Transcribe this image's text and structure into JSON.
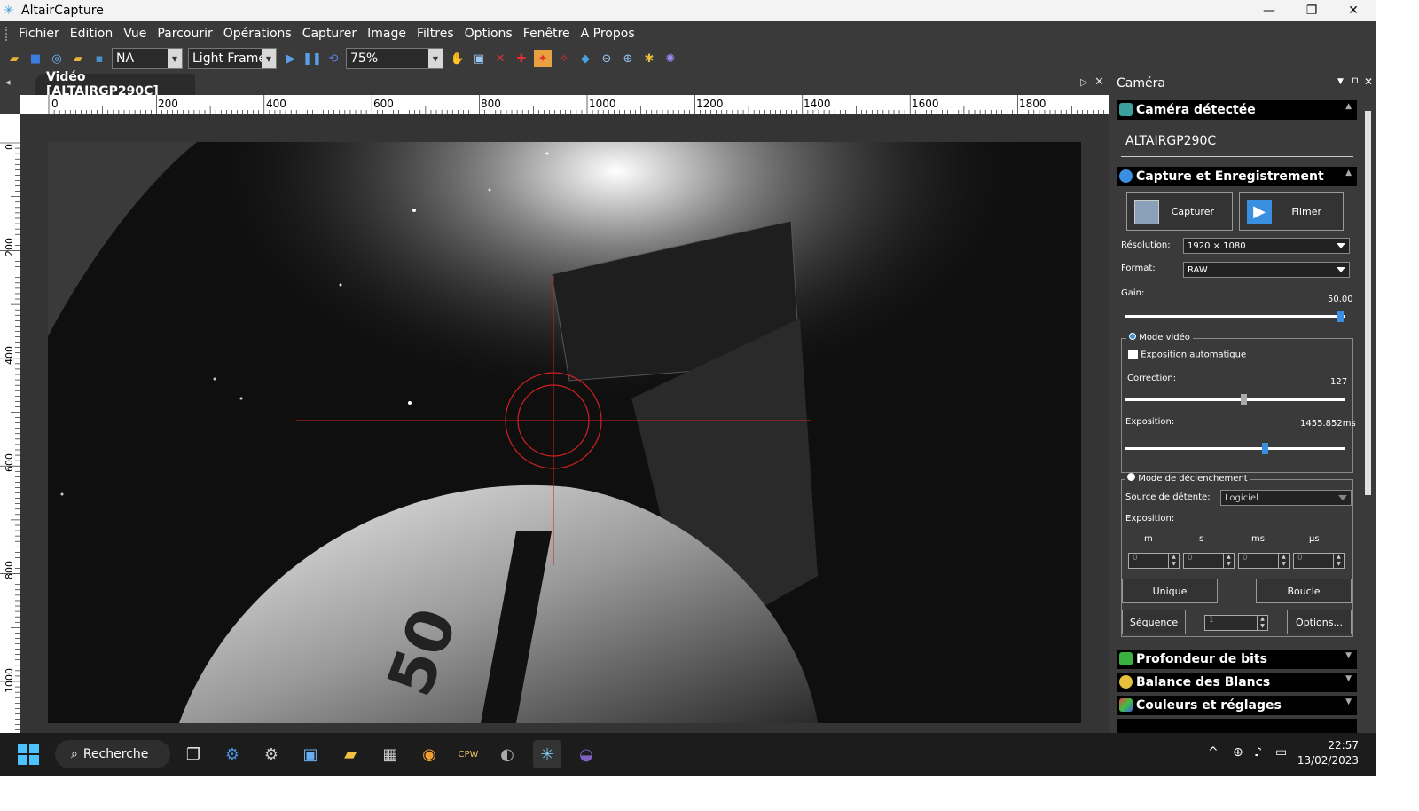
{
  "window": {
    "title": "AltairCapture",
    "minimize": "—",
    "restore": "❐",
    "close": "✕"
  },
  "menu": [
    "Fichier",
    "Edition",
    "Vue",
    "Parcourir",
    "Opérations",
    "Capturer",
    "Image",
    "Filtres",
    "Options",
    "Fenêtre",
    "A Propos"
  ],
  "toolbar": {
    "filter_value": "NA",
    "frame_type": "Light Frame",
    "zoom": "75%"
  },
  "document": {
    "tab_label": "Vidéo [ALTAIRGP290C]",
    "ruler_h_ticks": [
      "0",
      "200",
      "400",
      "600",
      "800",
      "1000",
      "1200",
      "1400",
      "1600",
      "1800"
    ],
    "ruler_v_ticks": [
      "0",
      "200",
      "400",
      "600",
      "800",
      "1000"
    ]
  },
  "panel": {
    "title": "Caméra",
    "camera_section": "Caméra détectée",
    "camera_name": "ALTAIRGP290C",
    "capture_section": "Capture et Enregistrement",
    "capture_button": "Capturer",
    "film_button": "Filmer",
    "resolution_label": "Résolution:",
    "resolution_value": "1920 × 1080",
    "format_label": "Format:",
    "format_value": "RAW",
    "gain_label": "Gain:",
    "gain_value": "50.00",
    "video_mode_label": "Mode vidéo",
    "auto_exposure_label": "Exposition automatique",
    "correction_label": "Correction:",
    "correction_value": "127",
    "exposure_label": "Exposition:",
    "exposure_value": "1455.852ms",
    "trigger_mode_label": "Mode de déclenchement",
    "trigger_source_label": "Source de détente:",
    "trigger_source_value": "Logiciel",
    "trigger_exposure_label": "Exposition:",
    "unit_m": "m",
    "unit_s": "s",
    "unit_ms": "ms",
    "unit_us": "µs",
    "spin_m": "0",
    "spin_s": "0",
    "spin_ms": "0",
    "spin_us": "0",
    "spin_seq": "1",
    "single_button": "Unique",
    "loop_button": "Boucle",
    "sequence_button": "Séquence",
    "options_button": "Options...",
    "bitdepth_section": "Profondeur de bits",
    "whitebalance_section": "Balance des Blancs",
    "colors_section": "Couleurs et réglages",
    "gain_fraction": 0.99,
    "correction_fraction": 0.54,
    "exposure_fraction": 0.64,
    "accent_color": "#3a8fe0"
  },
  "image": {
    "lens_marking": "50"
  },
  "taskbar": {
    "search_label": "Recherche",
    "time": "22:57",
    "date": "13/02/2023"
  }
}
